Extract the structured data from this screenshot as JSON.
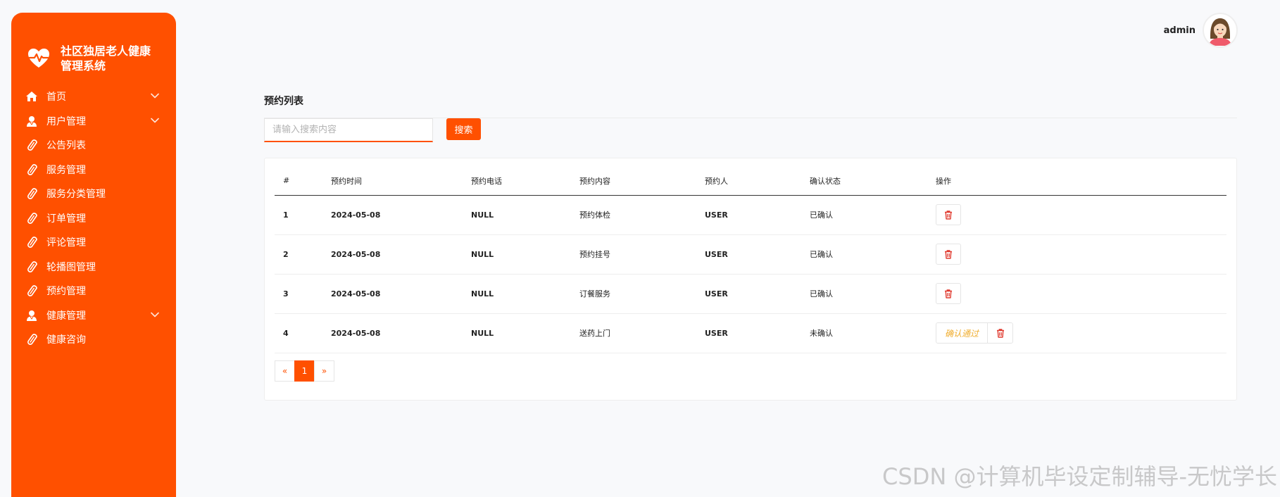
{
  "app": {
    "title": "社区独居老人健康管理系统",
    "accent_color": "#ff5000",
    "logo_icon": "heart-pulse-icon"
  },
  "sidebar": {
    "items": [
      {
        "label": "首页",
        "icon": "home-icon",
        "expandable": true
      },
      {
        "label": "用户管理",
        "icon": "user-icon",
        "expandable": true
      },
      {
        "label": "公告列表",
        "icon": "link-icon",
        "expandable": false
      },
      {
        "label": "服务管理",
        "icon": "link-icon",
        "expandable": false
      },
      {
        "label": "服务分类管理",
        "icon": "link-icon",
        "expandable": false
      },
      {
        "label": "订单管理",
        "icon": "link-icon",
        "expandable": false
      },
      {
        "label": "评论管理",
        "icon": "link-icon",
        "expandable": false
      },
      {
        "label": "轮播图管理",
        "icon": "link-icon",
        "expandable": false
      },
      {
        "label": "预约管理",
        "icon": "link-icon",
        "expandable": false
      },
      {
        "label": "健康管理",
        "icon": "user-icon",
        "expandable": true
      },
      {
        "label": "健康咨询",
        "icon": "link-icon",
        "expandable": false
      }
    ]
  },
  "header": {
    "username": "admin"
  },
  "main": {
    "title": "预约列表",
    "search": {
      "placeholder": "请输入搜索内容",
      "value": ""
    },
    "search_button": "搜索",
    "table": {
      "columns": [
        "#",
        "预约时间",
        "预约电话",
        "预约内容",
        "预约人",
        "确认状态",
        "操作"
      ],
      "rows": [
        {
          "id": "1",
          "time": "2024-05-08",
          "phone": "NULL",
          "content": "预约体检",
          "person": "USER",
          "status": "已确认",
          "confirm_button": ""
        },
        {
          "id": "2",
          "time": "2024-05-08",
          "phone": "NULL",
          "content": "预约挂号",
          "person": "USER",
          "status": "已确认",
          "confirm_button": ""
        },
        {
          "id": "3",
          "time": "2024-05-08",
          "phone": "NULL",
          "content": "订餐服务",
          "person": "USER",
          "status": "已确认",
          "confirm_button": ""
        },
        {
          "id": "4",
          "time": "2024-05-08",
          "phone": "NULL",
          "content": "送药上门",
          "person": "USER",
          "status": "未确认",
          "confirm_button": "确认通过"
        }
      ]
    },
    "pagination": {
      "prev": "«",
      "pages": [
        "1"
      ],
      "current": "1",
      "next": "»"
    }
  },
  "watermark": "CSDN @计算机毕设定制辅导-无忧学长"
}
